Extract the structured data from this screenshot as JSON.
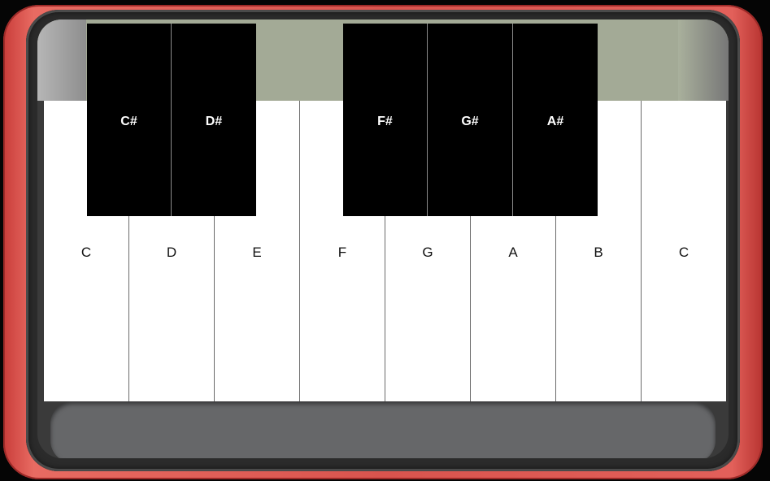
{
  "piano": {
    "white_keys": [
      {
        "label": "C"
      },
      {
        "label": "D"
      },
      {
        "label": "E"
      },
      {
        "label": "F"
      },
      {
        "label": "G"
      },
      {
        "label": "A"
      },
      {
        "label": "B"
      },
      {
        "label": "C"
      }
    ],
    "black_keys": [
      {
        "label": "C#"
      },
      {
        "label": "D#"
      },
      {
        "label": "F#"
      },
      {
        "label": "G#"
      },
      {
        "label": "A#"
      }
    ]
  }
}
